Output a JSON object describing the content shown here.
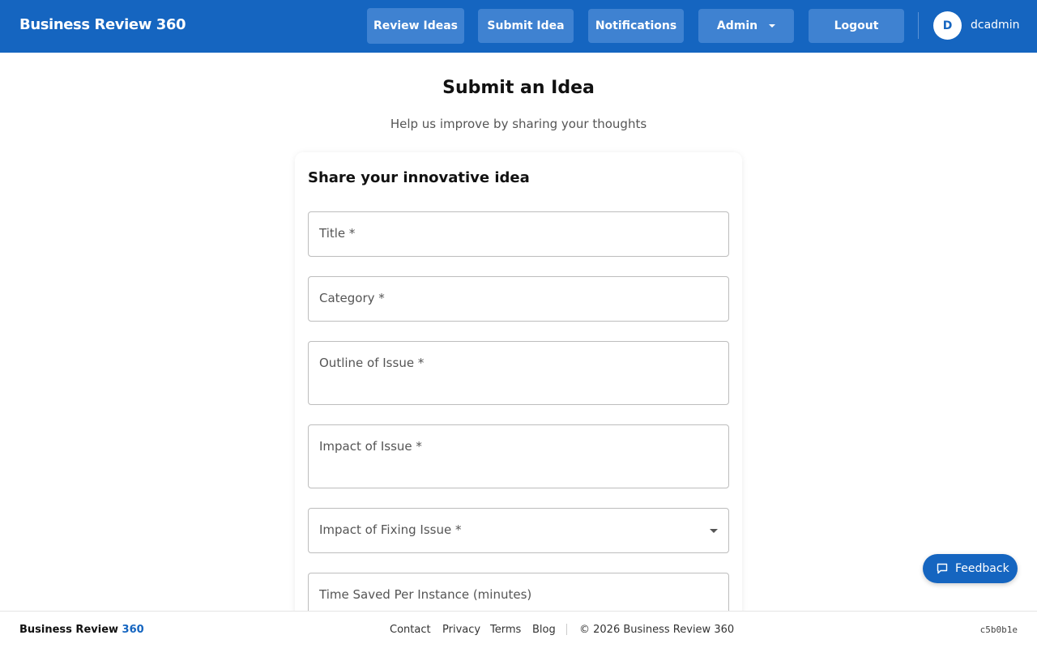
{
  "header": {
    "brand": "Business Review 360",
    "nav": {
      "review_ideas": "Review Ideas",
      "submit_idea": "Submit Idea",
      "notifications": "Notifications",
      "admin": "Admin",
      "logout": "Logout"
    },
    "user": {
      "avatar_initial": "D",
      "username": "dcadmin"
    }
  },
  "main": {
    "title": "Submit an Idea",
    "subtitle": "Help us improve by sharing your thoughts",
    "card": {
      "title": "Share your innovative idea",
      "fields": {
        "title": "Title *",
        "category": "Category *",
        "outline": "Outline of Issue *",
        "impact": "Impact of Issue *",
        "impact_fixing": "Impact of Fixing Issue *",
        "time_saved": "Time Saved Per Instance (minutes)"
      }
    }
  },
  "feedback_button": {
    "label": "Feedback",
    "icon": "chat-bubble-icon"
  },
  "footer": {
    "brand_text": "Business Review ",
    "brand_accent": "360",
    "links": {
      "contact": "Contact",
      "privacy": "Privacy",
      "terms": "Terms",
      "blog": "Blog"
    },
    "copyright": "© 2026 Business Review 360",
    "build_hash": "c5b0b1e"
  },
  "colors": {
    "primary": "#1565c0",
    "nav_button": "#3f82d1",
    "border": "#bdbdbd"
  }
}
